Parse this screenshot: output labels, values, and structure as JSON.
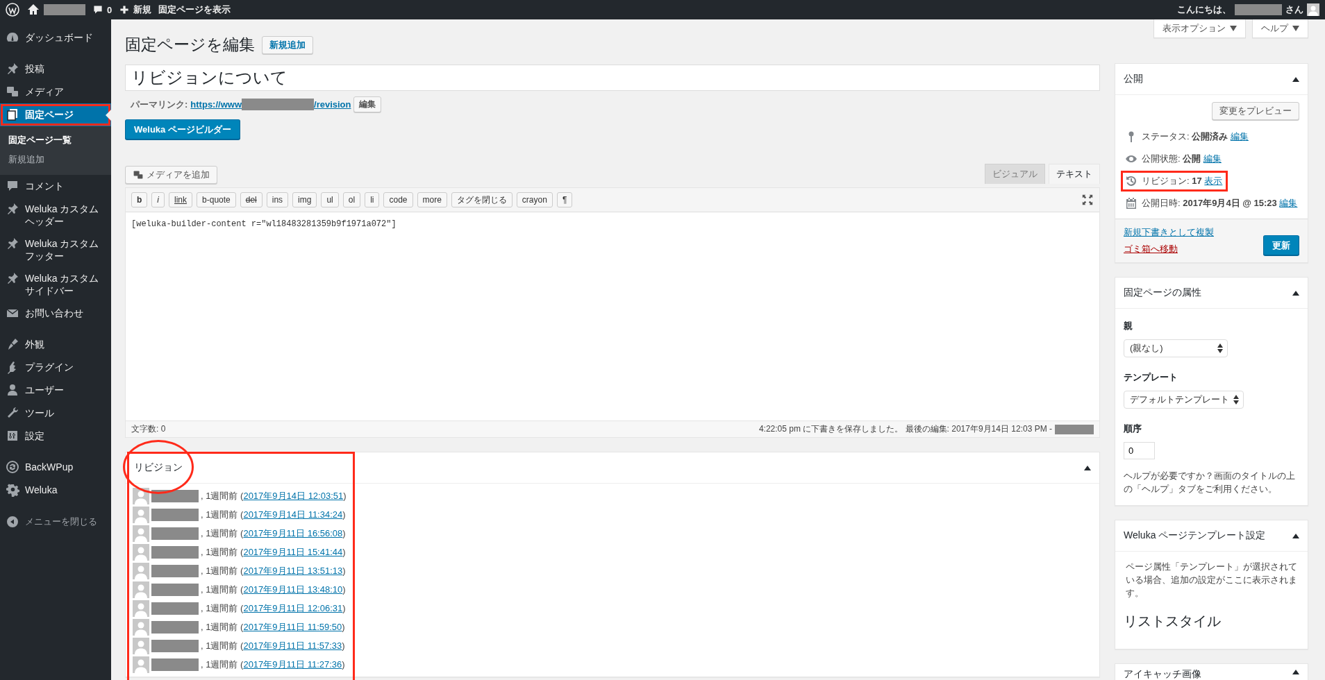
{
  "admin_bar": {
    "comment_count": "0",
    "new_label": "新規",
    "view_label": "固定ページを表示",
    "greeting": "こんにちは、",
    "greeting_suffix": "さん"
  },
  "sidebar": {
    "groups": [
      {
        "items": [
          {
            "label": "ダッシュボード",
            "selected": false,
            "highlighted": false
          }
        ]
      },
      {
        "items": [
          {
            "label": "投稿",
            "selected": false,
            "highlighted": false
          },
          {
            "label": "メディア",
            "selected": false,
            "highlighted": false
          },
          {
            "label": "固定ページ",
            "selected": true,
            "highlighted": true,
            "children": [
              {
                "label": "固定ページ一覧",
                "selected": true
              },
              {
                "label": "新規追加",
                "selected": false
              }
            ]
          },
          {
            "label": "コメント",
            "selected": false,
            "highlighted": false
          },
          {
            "label": "Weluka カスタムヘッダー",
            "selected": false,
            "highlighted": false
          },
          {
            "label": "Weluka カスタムフッター",
            "selected": false,
            "highlighted": false
          },
          {
            "label": "Weluka カスタムサイドバー",
            "selected": false,
            "highlighted": false
          },
          {
            "label": "お問い合わせ",
            "selected": false,
            "highlighted": false
          }
        ]
      },
      {
        "items": [
          {
            "label": "外観",
            "selected": false,
            "highlighted": false
          },
          {
            "label": "プラグイン",
            "selected": false,
            "highlighted": false
          },
          {
            "label": "ユーザー",
            "selected": false,
            "highlighted": false
          },
          {
            "label": "ツール",
            "selected": false,
            "highlighted": false
          },
          {
            "label": "設定",
            "selected": false,
            "highlighted": false
          }
        ]
      },
      {
        "items": [
          {
            "label": "BackWPup",
            "selected": false,
            "highlighted": false
          },
          {
            "label": "Weluka",
            "selected": false,
            "highlighted": false
          }
        ]
      }
    ],
    "collapse": "メニューを閉じる"
  },
  "screen_options": {
    "options": "表示オプション",
    "help": "ヘルプ"
  },
  "page_header": {
    "title": "固定ページを編集",
    "add_new": "新規追加"
  },
  "post_title": "リビジョンについて",
  "permalink": {
    "label": "パーマリンク:",
    "url_start": "https://www",
    "url_end": "/revision",
    "edit": "編集"
  },
  "builder_button": "Weluka ページビルダー",
  "editor": {
    "add_media": "メディアを追加",
    "tabs": [
      {
        "label": "ビジュアル",
        "selected": false
      },
      {
        "label": "テキスト",
        "selected": true
      }
    ],
    "quicktags": [
      {
        "label": "b",
        "kind": "bold"
      },
      {
        "label": "i",
        "kind": "italic"
      },
      {
        "label": "link",
        "kind": "underline"
      },
      {
        "label": "b-quote",
        "kind": "plain"
      },
      {
        "label": "del",
        "kind": "strike"
      },
      {
        "label": "ins",
        "kind": "plain"
      },
      {
        "label": "img",
        "kind": "plain"
      },
      {
        "label": "ul",
        "kind": "plain"
      },
      {
        "label": "ol",
        "kind": "plain"
      },
      {
        "label": "li",
        "kind": "plain"
      },
      {
        "label": "code",
        "kind": "plain"
      },
      {
        "label": "more",
        "kind": "plain"
      },
      {
        "label": "タグを閉じる",
        "kind": "plain"
      },
      {
        "label": "crayon",
        "kind": "plain"
      },
      {
        "label": "¶",
        "kind": "plain"
      }
    ],
    "content": "[weluka-builder-content r=\"wl18483281359b9f1971a072\"]",
    "word_count": "文字数: 0",
    "autosave": "4:22:05 pm に下書きを保存しました。 最後の編集: 2017年9月14日 12:03 PM -"
  },
  "revisions": {
    "title": "リビジョン",
    "highlighted": true,
    "circled": true,
    "rows": [
      {
        "prefix": ", 1週間前 (",
        "date": "2017年9月14日 12:03:51",
        "suffix": ")"
      },
      {
        "prefix": ", 1週間前 (",
        "date": "2017年9月14日 11:34:24",
        "suffix": ")"
      },
      {
        "prefix": ", 1週間前 (",
        "date": "2017年9月11日 16:56:08",
        "suffix": ")"
      },
      {
        "prefix": ", 1週間前 (",
        "date": "2017年9月11日 15:41:44",
        "suffix": ")"
      },
      {
        "prefix": ", 1週間前 (",
        "date": "2017年9月11日 13:51:13",
        "suffix": ")"
      },
      {
        "prefix": ", 1週間前 (",
        "date": "2017年9月11日 13:48:10",
        "suffix": ")"
      },
      {
        "prefix": ", 1週間前 (",
        "date": "2017年9月11日 12:06:31",
        "suffix": ")"
      },
      {
        "prefix": ", 1週間前 (",
        "date": "2017年9月11日 11:59:50",
        "suffix": ")"
      },
      {
        "prefix": ", 1週間前 (",
        "date": "2017年9月11日 11:57:33",
        "suffix": ")"
      },
      {
        "prefix": ", 1週間前 (",
        "date": "2017年9月11日 11:27:36",
        "suffix": ")"
      }
    ]
  },
  "publish": {
    "title": "公開",
    "preview": "変更をプレビュー",
    "rows": [
      {
        "label": "ステータス:",
        "value": "公開済み",
        "link": "編集",
        "highlighted": false
      },
      {
        "label": "公開状態:",
        "value": "公開",
        "link": "編集",
        "highlighted": false
      },
      {
        "label": "リビジョン:",
        "value": "17",
        "link": "表示",
        "highlighted": true
      },
      {
        "label": "公開日時:",
        "value": "2017年9月4日 @ 15:23",
        "link": "編集",
        "highlighted": false
      }
    ],
    "copy": "新規下書きとして複製",
    "trash": "ゴミ箱へ移動",
    "update": "更新"
  },
  "attributes": {
    "title": "固定ページの属性",
    "parent_label": "親",
    "parent_value": "(親なし)",
    "template_label": "テンプレート",
    "template_value": "デフォルトテンプレート",
    "order_label": "順序",
    "order_value": "0",
    "help": "ヘルプが必要ですか？画面のタイトルの上の「ヘルプ」タブをご利用ください。"
  },
  "weluka_template": {
    "title": "Weluka ページテンプレート設定",
    "note": "ページ属性「テンプレート」が選択されている場合、追加の設定がここに表示されます。",
    "heading": "リストスタイル"
  },
  "featured_image": {
    "title": "アイキャッチ画像"
  }
}
